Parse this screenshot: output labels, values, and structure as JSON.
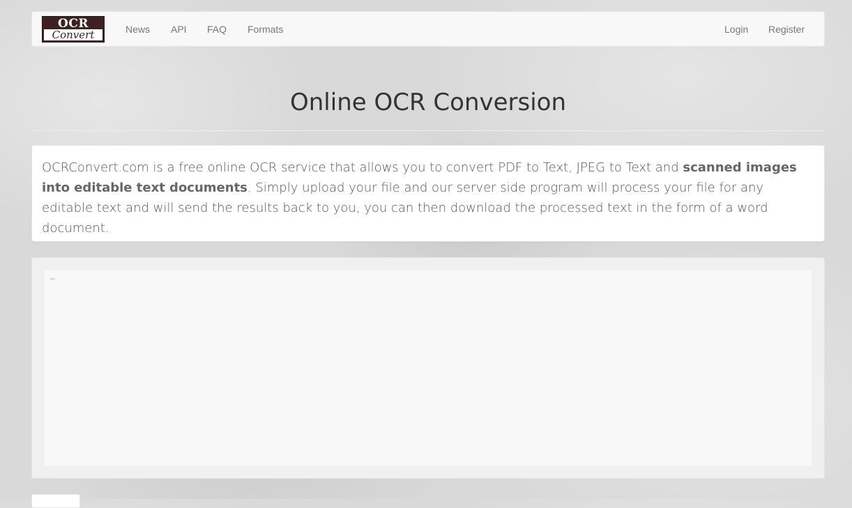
{
  "nav": {
    "logo": {
      "top": "OCR",
      "bottom": "Convert"
    },
    "left_links": [
      "News",
      "API",
      "FAQ",
      "Formats"
    ],
    "right_links": [
      "Login",
      "Register"
    ]
  },
  "header": {
    "title": "Online OCR Conversion"
  },
  "intro": {
    "part1": "OCRConvert.com is a free online OCR service that allows you to convert PDF to Text, JPEG to Text and ",
    "bold": "scanned images into editable text documents",
    "part2": ". Simply upload your file and our server side program will process your file for any editable text and will send the results back to you, you can then download the processed text in the form of a word document."
  },
  "converter": {
    "back_icon": "left-arrow-icon",
    "back_glyph": "←"
  },
  "colors": {
    "navbar_bg": "#f8f8f8",
    "logo_bg": "#3d2120",
    "link": "#777777",
    "panel_bg": "#ffffff",
    "converter_bg": "#f0f0f0"
  }
}
